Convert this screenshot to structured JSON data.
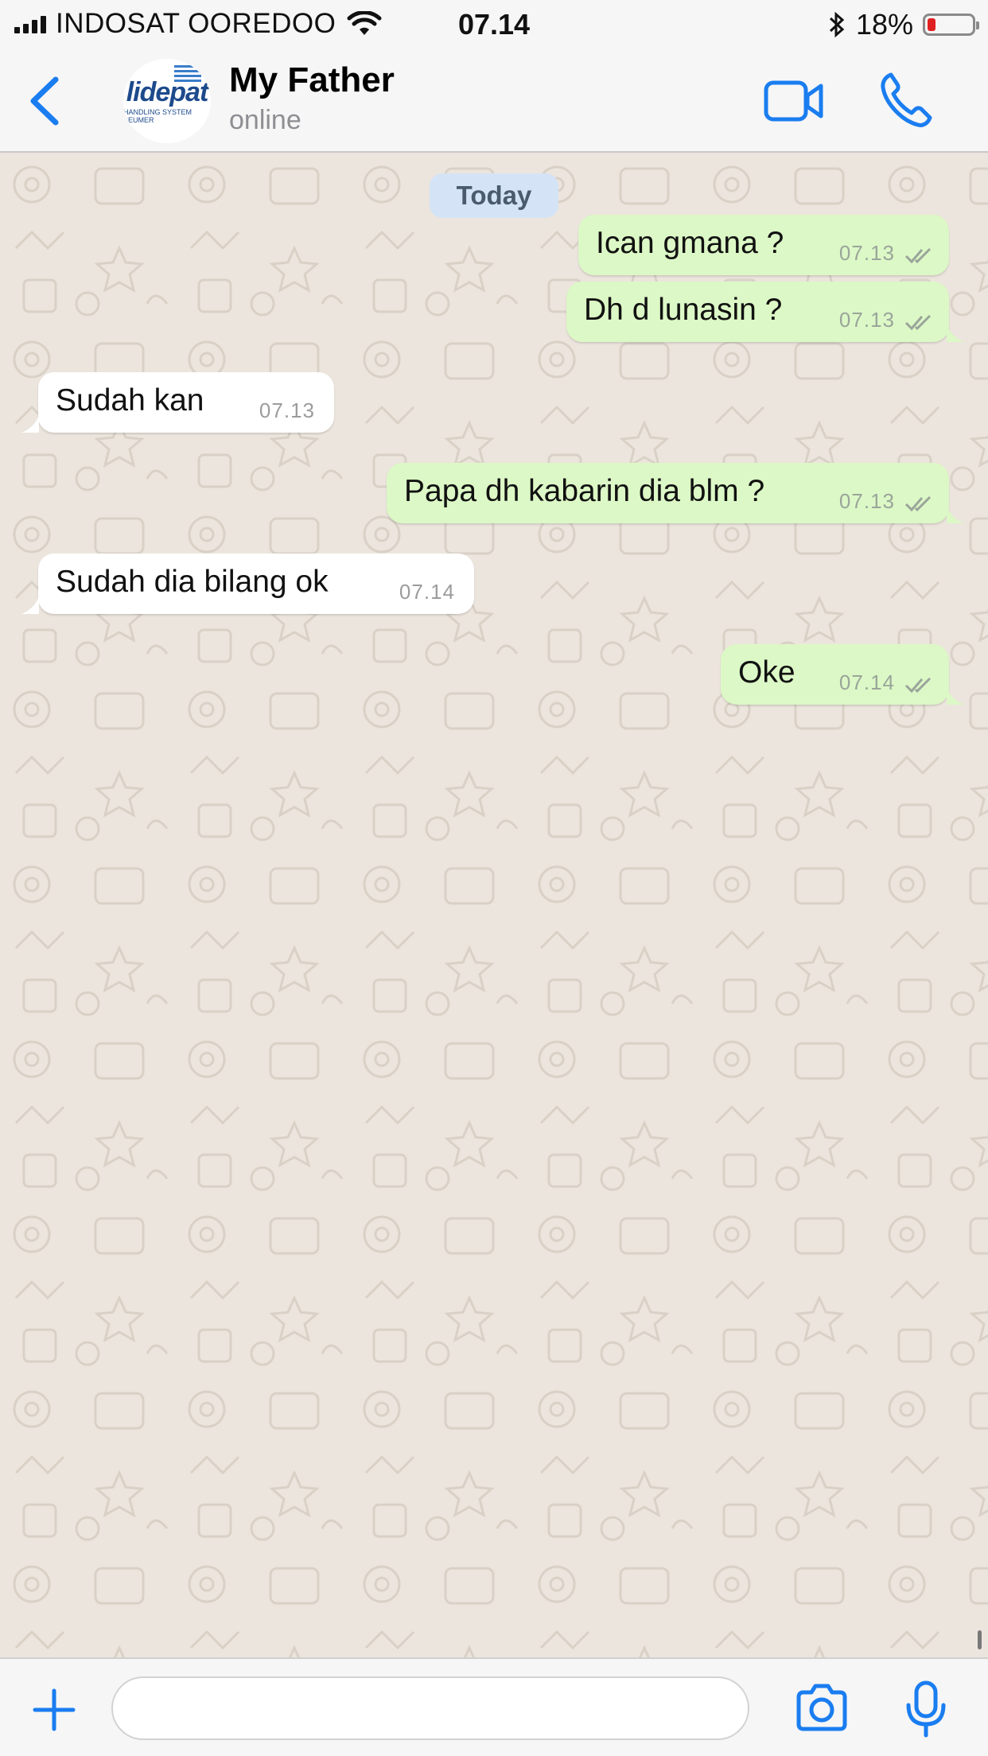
{
  "status_bar": {
    "carrier": "INDOSAT OOREDOO",
    "time": "07.14",
    "battery_percent_label": "18%",
    "battery_level": 0.18
  },
  "header": {
    "contact_name": "My Father",
    "contact_status": "online",
    "avatar_logo_text": "lidepat",
    "avatar_logo_sub": "HANDLING SYSTEM BEUMER",
    "accent_color": "#1a7df0"
  },
  "chat": {
    "date_label": "Today",
    "messages": [
      {
        "direction": "out",
        "text": "Ican gmana ?",
        "time": "07.13",
        "read": true
      },
      {
        "direction": "out",
        "text": "Dh d lunasin ?",
        "time": "07.13",
        "read": true
      },
      {
        "direction": "in",
        "text": "Sudah kan",
        "time": "07.13"
      },
      {
        "direction": "out",
        "text": "Papa dh kabarin dia blm ?",
        "time": "07.13",
        "read": true
      },
      {
        "direction": "in",
        "text": "Sudah dia bilang ok",
        "time": "07.14"
      },
      {
        "direction": "out",
        "text": "Oke",
        "time": "07.14",
        "read": true
      }
    ],
    "outgoing_color": "#dcf8c6",
    "incoming_color": "#ffffff"
  },
  "input_bar": {
    "message_placeholder": ""
  },
  "icons": [
    "back-chevron-icon",
    "video-call-icon",
    "phone-icon",
    "plus-icon",
    "camera-icon",
    "microphone-icon",
    "wifi-icon",
    "bluetooth-icon",
    "battery-icon",
    "signal-icon",
    "double-check-icon"
  ]
}
